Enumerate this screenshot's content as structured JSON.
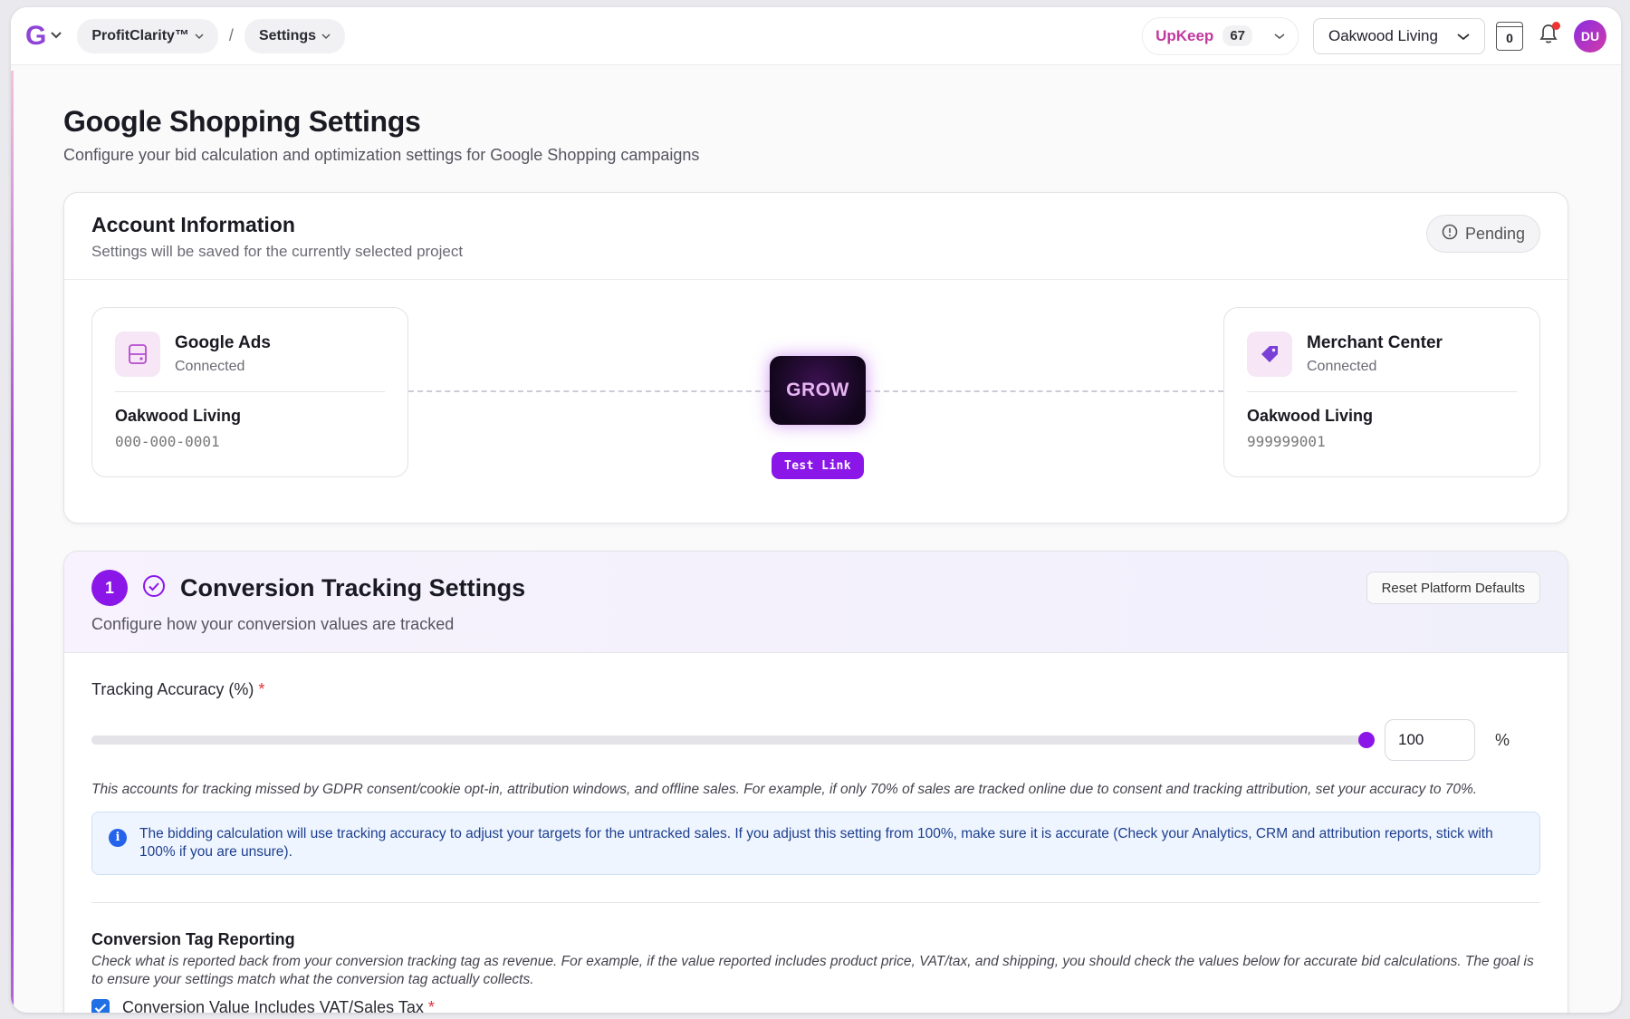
{
  "topbar": {
    "logo_letter": "G",
    "app_name": "ProfitClarity™",
    "breadcrumb_separator": "/",
    "breadcrumb_current": "Settings",
    "upkeep_label": "UpKeep",
    "upkeep_count": "67",
    "project_name": "Oakwood Living",
    "calendar_day": "0",
    "avatar_initials": "DU"
  },
  "page": {
    "title": "Google Shopping Settings",
    "subtitle": "Configure your bid calculation and optimization settings for Google Shopping campaigns"
  },
  "account": {
    "title": "Account Information",
    "subtitle": "Settings will be saved for the currently selected project",
    "status": "Pending",
    "google_ads": {
      "name": "Google Ads",
      "status": "Connected",
      "account_name": "Oakwood Living",
      "account_id": "000-000-0001"
    },
    "merchant_center": {
      "name": "Merchant Center",
      "status": "Connected",
      "account_name": "Oakwood Living",
      "account_id": "999999001"
    },
    "grow_label": "GROW",
    "test_link_label": "Test Link"
  },
  "conversion": {
    "step": "1",
    "title": "Conversion Tracking Settings",
    "subtitle": "Configure how your conversion values are tracked",
    "reset_label": "Reset Platform Defaults",
    "tracking_label": "Tracking Accuracy (%)",
    "required_mark": "*",
    "tracking_value": 100,
    "tracking_value_text": "100",
    "percent_sign": "%",
    "tracking_help": "This accounts for tracking missed by GDPR consent/cookie opt-in, attribution windows, and offline sales. For example, if only 70% of sales are tracked online due to consent and tracking attribution, set your accuracy to 70%.",
    "info_text": "The bidding calculation will use tracking accuracy to adjust your targets for the untracked sales. If you adjust this setting from 100%, make sure it is accurate (Check your Analytics, CRM and attribution reports, stick with 100% if you are unsure).",
    "tag_title": "Conversion Tag Reporting",
    "tag_help": "Check what is reported back from your conversion tracking tag as revenue. For example, if the value reported includes product price, VAT/tax, and shipping, you should check the values below for accurate bid calculations. The goal is to ensure your settings match what the conversion tag actually collects.",
    "vat_label": "Conversion Value Includes VAT/Sales Tax",
    "vat_checked": true
  },
  "colors": {
    "accent": "#8b16e8",
    "brand_pink": "#c2389e",
    "info_blue": "#2563eb"
  },
  "icons": {
    "logo_dropdown": "chevron-down-icon",
    "pending": "alert-circle-icon",
    "google_ads": "google-ads-icon",
    "merchant_center": "tag-icon",
    "step_check": "check-circle-icon",
    "info": "info-icon",
    "notifications": "bell-icon"
  }
}
